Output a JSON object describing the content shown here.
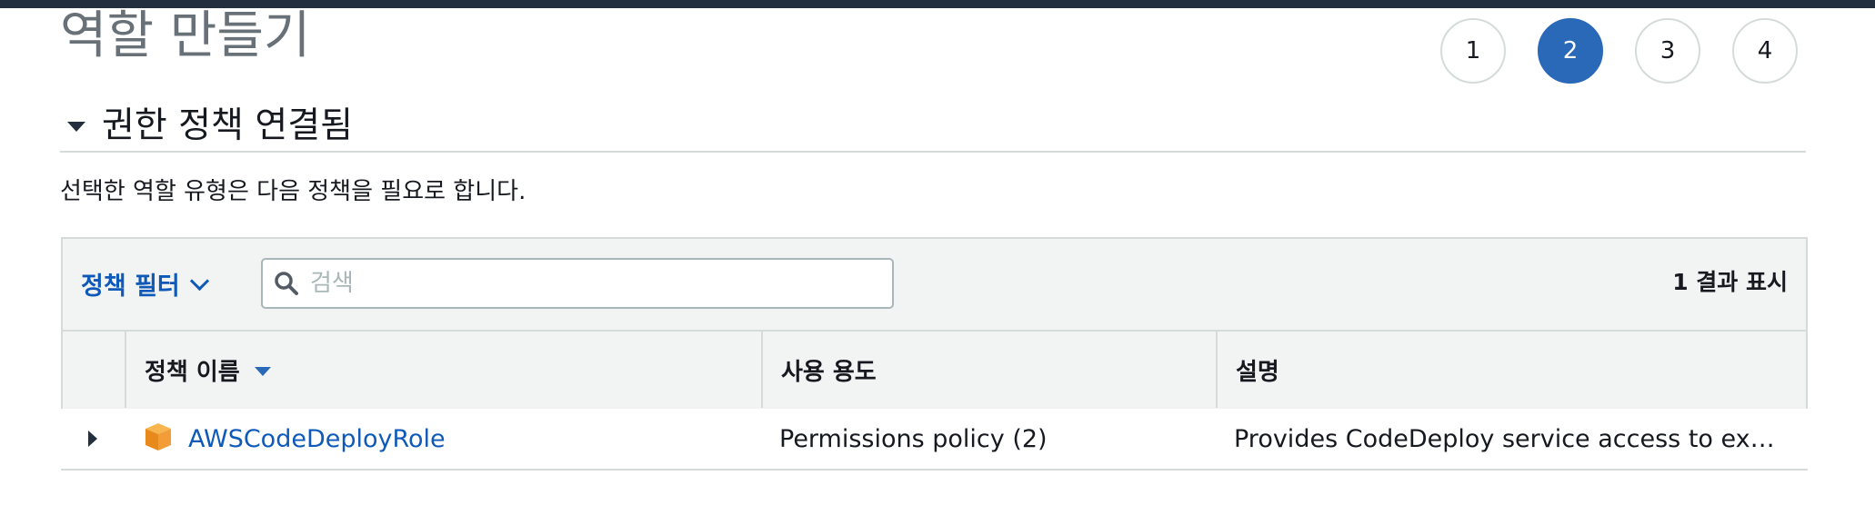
{
  "page": {
    "title": "역할 만들기"
  },
  "steps": [
    {
      "label": "1",
      "active": false
    },
    {
      "label": "2",
      "active": true
    },
    {
      "label": "3",
      "active": false
    },
    {
      "label": "4",
      "active": false
    }
  ],
  "section": {
    "title": "권한 정책 연결됨",
    "description": "선택한 역할 유형은 다음 정책을 필요로 합니다."
  },
  "filter": {
    "label": "정책 필터",
    "search_placeholder": "검색",
    "search_value": "",
    "result_count": "1 결과 표시"
  },
  "table": {
    "columns": {
      "name": "정책 이름",
      "usage": "사용 용도",
      "description": "설명"
    },
    "rows": [
      {
        "name": "AWSCodeDeployRole",
        "usage": "Permissions policy (2)",
        "description": "Provides CodeDeploy service access to expand tags and interact with Auto Scaling on your behalf."
      }
    ]
  },
  "colors": {
    "topbar": "#232f3e",
    "accent": "#2a68b8",
    "link": "#0f5ab8",
    "border": "#d5dbdb",
    "header_bg": "#f2f3f3",
    "policy_icon": "#f29d38"
  }
}
